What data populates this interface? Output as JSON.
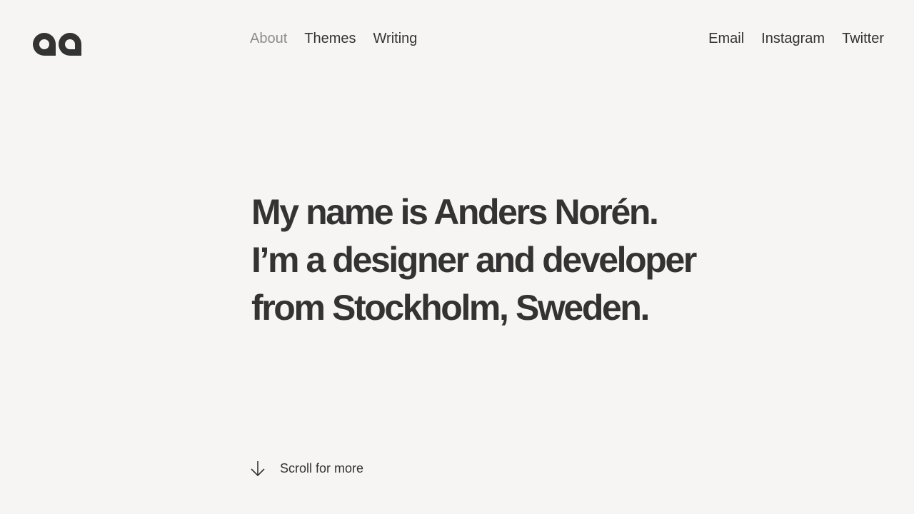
{
  "logo": {
    "label": "aa"
  },
  "nav": {
    "items": [
      {
        "label": "About"
      },
      {
        "label": "Themes"
      },
      {
        "label": "Writing"
      }
    ]
  },
  "social": {
    "items": [
      {
        "label": "Email"
      },
      {
        "label": "Instagram"
      },
      {
        "label": "Twitter"
      }
    ]
  },
  "hero": {
    "lines": [
      "My name is Anders Norén.",
      "I’m a designer and developer",
      "from Stockholm, Sweden."
    ]
  },
  "scroll": {
    "label": "Scroll for more",
    "icon": "arrow-down-icon"
  },
  "colors": {
    "background": "#f6f5f3",
    "text": "#333333",
    "active_nav": "#8c8c8c"
  }
}
